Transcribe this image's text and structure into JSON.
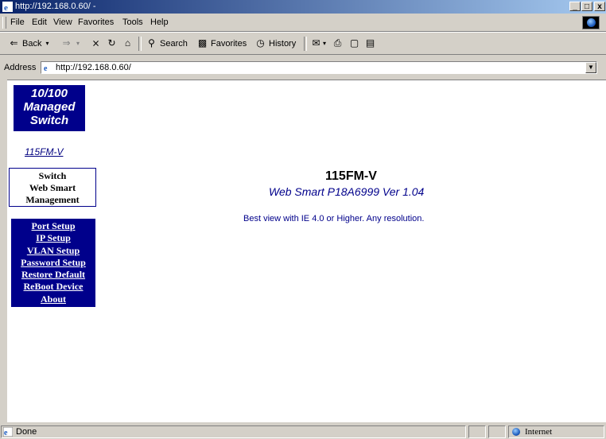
{
  "window": {
    "title": "http://192.168.0.60/ -",
    "controls": [
      "_",
      "□",
      "x"
    ]
  },
  "menu": [
    "File",
    "Edit",
    "View",
    "Favorites",
    "Tools",
    "Help"
  ],
  "toolbar": {
    "back": "Back",
    "search": "Search",
    "favorites": "Favorites",
    "history": "History"
  },
  "address": {
    "label": "Address",
    "url": "http://192.168.0.60/"
  },
  "sidebar": {
    "badge_lines": [
      "10/100",
      "Managed",
      "Switch"
    ],
    "model_link": "115FM-V",
    "box_lines": [
      "Switch",
      "Web Smart",
      "Management"
    ],
    "nav": [
      "Port Setup",
      "IP Setup",
      "VLAN Setup",
      "Password Setup",
      "Restore Default",
      "ReBoot Device",
      "About"
    ]
  },
  "main": {
    "title": "115FM-V",
    "subtitle": "Web Smart P18A6999 Ver 1.04",
    "note": "Best view with IE 4.0 or Higher. Any resolution."
  },
  "status": {
    "left": "Done",
    "zone": "Internet"
  }
}
